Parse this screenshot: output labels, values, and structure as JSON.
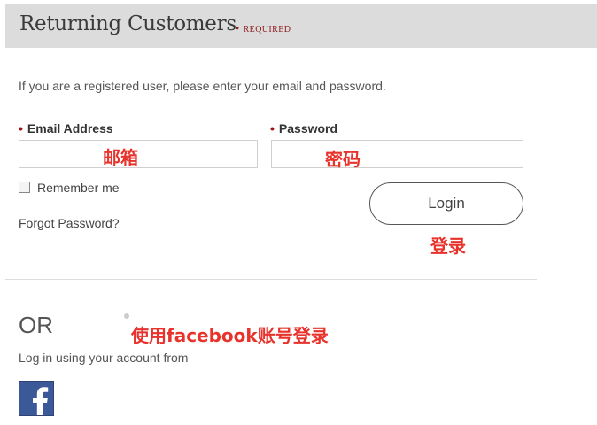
{
  "header": {
    "title": "Returning Customers",
    "required_label": "REQUIRED",
    "required_marker": "•"
  },
  "intro_text": "If you are a registered user, please enter your email and password.",
  "fields": {
    "email": {
      "label": "Email Address",
      "marker": "•",
      "value": "",
      "annotation": "邮箱"
    },
    "password": {
      "label": "Password",
      "marker": "•",
      "value": "",
      "annotation": "密码"
    }
  },
  "remember_me": {
    "label": "Remember me",
    "checked": false
  },
  "forgot_password": "Forgot Password?",
  "login_button": {
    "label": "Login",
    "annotation": "登录"
  },
  "social": {
    "or_text": "OR",
    "annotation": "使用facebook账号登录",
    "caption": "Log in using your account from",
    "icon": "facebook-icon"
  },
  "colors": {
    "required": "#8b1a1a",
    "annotation": "#e8322c",
    "facebook": "#3b5998",
    "header_bg": "#dcdcdc"
  }
}
